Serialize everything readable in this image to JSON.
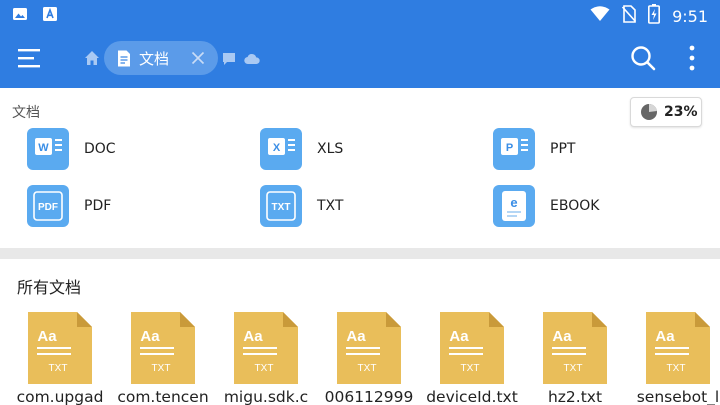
{
  "statusbar": {
    "time": "9:51",
    "left_icons": [
      "image-icon",
      "font-icon"
    ],
    "right_icons": [
      "wifi-icon",
      "no-sim-icon",
      "battery-charging-icon"
    ]
  },
  "toolbar": {
    "tab_label": "文档",
    "menu_icon": "hamburger-icon",
    "search_icon": "search-icon",
    "more_icon": "more-vertical-icon"
  },
  "categories": {
    "title": "文档",
    "usage_percent": "23%",
    "usage_value": 0.23,
    "items": [
      {
        "label": "DOC",
        "icon": "word-doc-icon",
        "badge": "W"
      },
      {
        "label": "XLS",
        "icon": "excel-doc-icon",
        "badge": "X"
      },
      {
        "label": "PPT",
        "icon": "powerpoint-doc-icon",
        "badge": "P"
      },
      {
        "label": "PDF",
        "icon": "pdf-doc-icon",
        "badge": "PDF"
      },
      {
        "label": "TXT",
        "icon": "txt-doc-icon",
        "badge": "TXT"
      },
      {
        "label": "EBOOK",
        "icon": "ebook-icon",
        "badge": "e"
      }
    ]
  },
  "all_documents": {
    "title": "所有文档",
    "file_badge": "TXT",
    "file_glyph": "Aa",
    "files": [
      {
        "name": "com.upgad"
      },
      {
        "name": "com.tencen"
      },
      {
        "name": "migu.sdk.c"
      },
      {
        "name": "006112999"
      },
      {
        "name": "deviceId.txt"
      },
      {
        "name": "hz2.txt"
      },
      {
        "name": "sensebot_l"
      }
    ]
  },
  "colors": {
    "primary": "#2f7de1",
    "chip": "#5b9be9",
    "category_icon": "#5aaaf0",
    "txt_file": "#e9be5a"
  }
}
